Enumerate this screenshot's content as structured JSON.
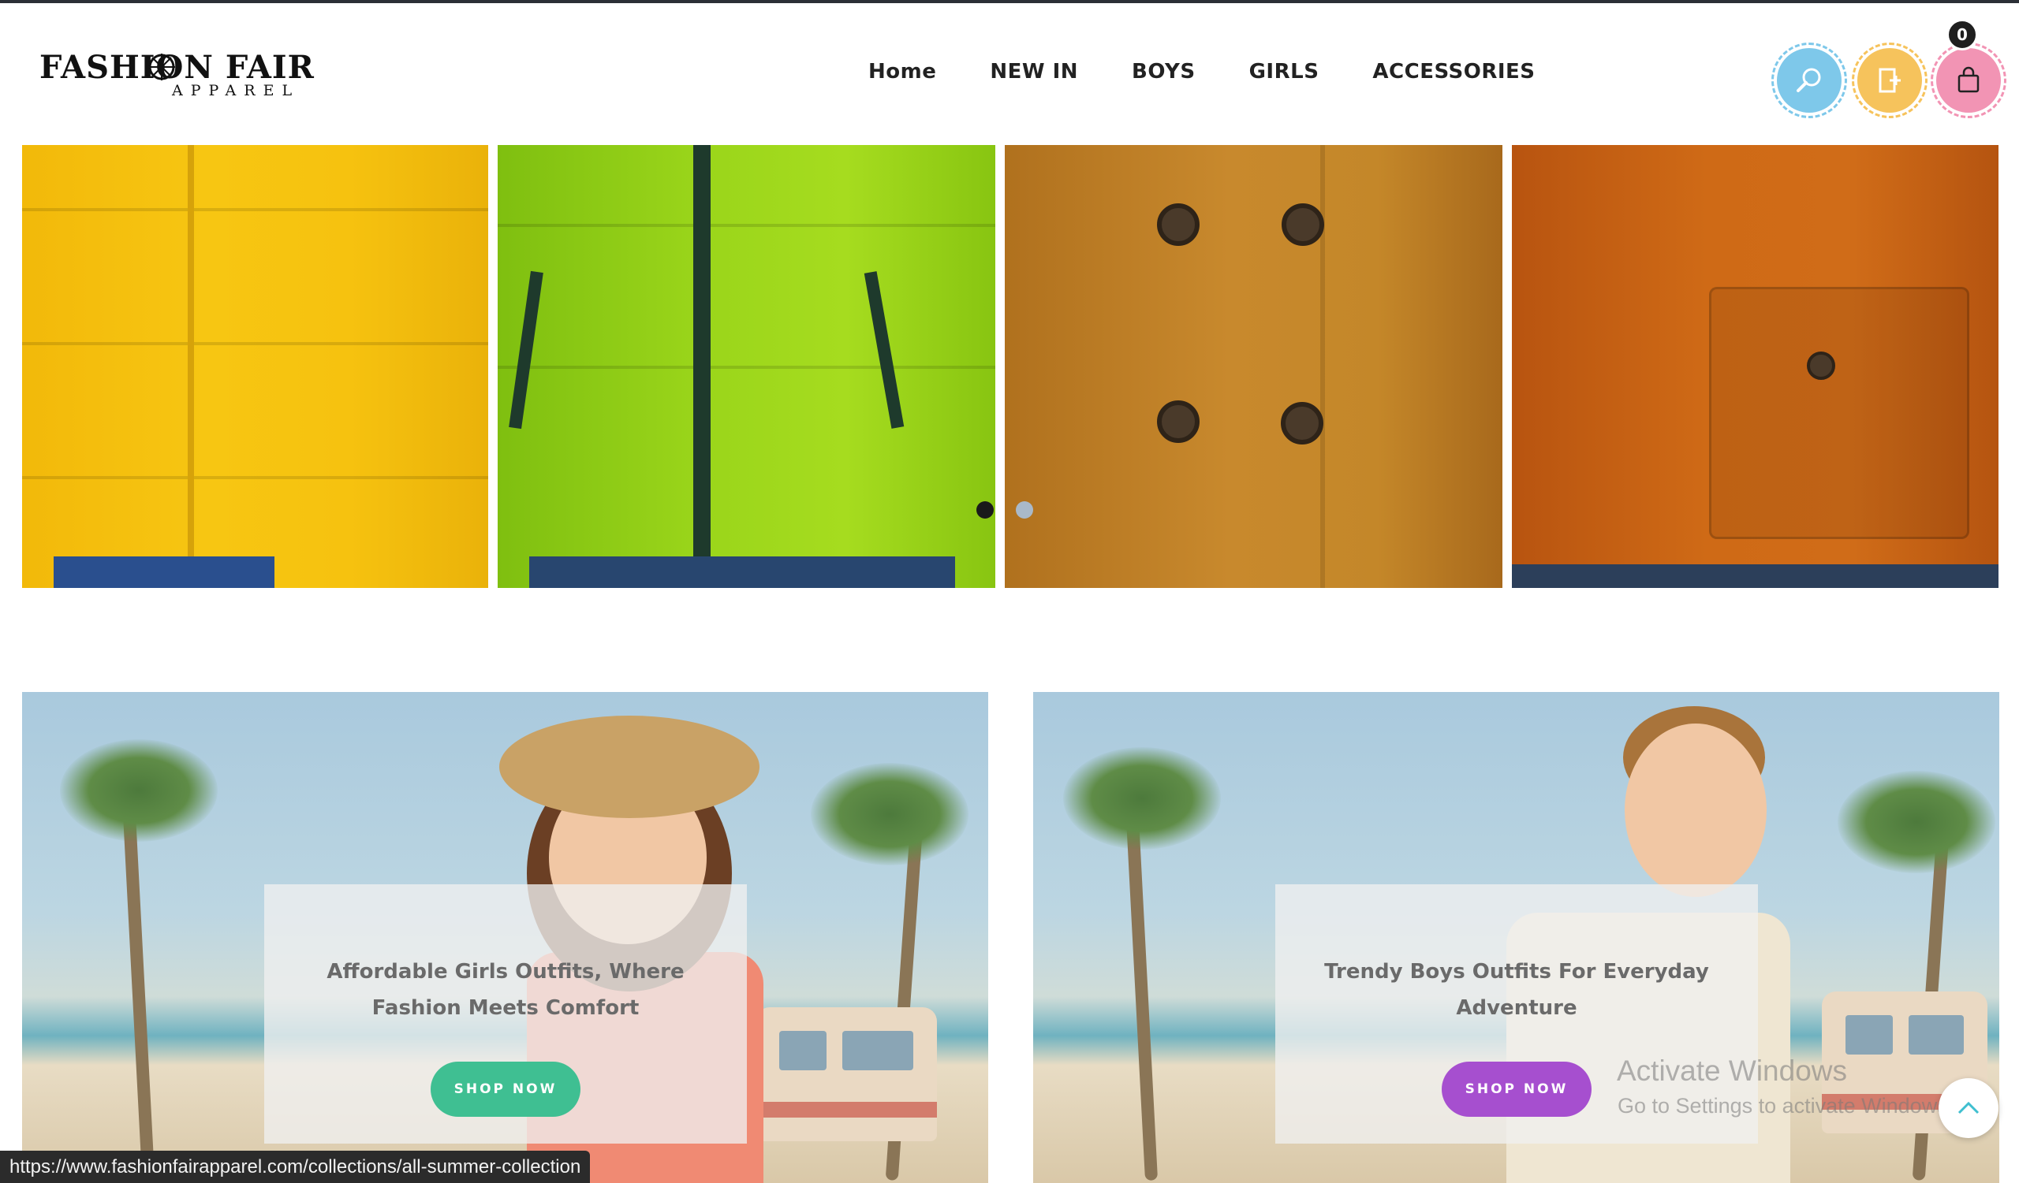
{
  "brand": {
    "name": "FASHION FAIR",
    "tagline": "APPAREL"
  },
  "nav": {
    "items": [
      "Home",
      "NEW IN",
      "BOYS",
      "GIRLS",
      "ACCESSORIES"
    ]
  },
  "header_icons": {
    "search": "search-icon",
    "account": "account-icon",
    "cart": "shopping-bag-icon",
    "cart_count": "0"
  },
  "product_strip": {
    "slides": [
      "yellow puffer jacket",
      "green puffer jacket",
      "camel wool coat",
      "orange utility jacket"
    ],
    "slider_dots": 2,
    "active_dot": 1
  },
  "banners": [
    {
      "title": "Affordable Girls Outfits, Where Fashion Meets Comfort",
      "button": "SHOP NOW",
      "button_color": "#3fbf92"
    },
    {
      "title": "Trendy Boys Outfits For Everyday Adventure",
      "button": "SHOP NOW",
      "button_color": "#a64fcf"
    }
  ],
  "status_url": "https://www.fashionfairapparel.com/collections/all-summer-collection",
  "watermark": {
    "title": "Activate Windows",
    "subtitle": "Go to Settings to activate Windows."
  },
  "colors": {
    "search": "#7ec8ea",
    "account": "#f6c35c",
    "cart": "#f294b4"
  }
}
